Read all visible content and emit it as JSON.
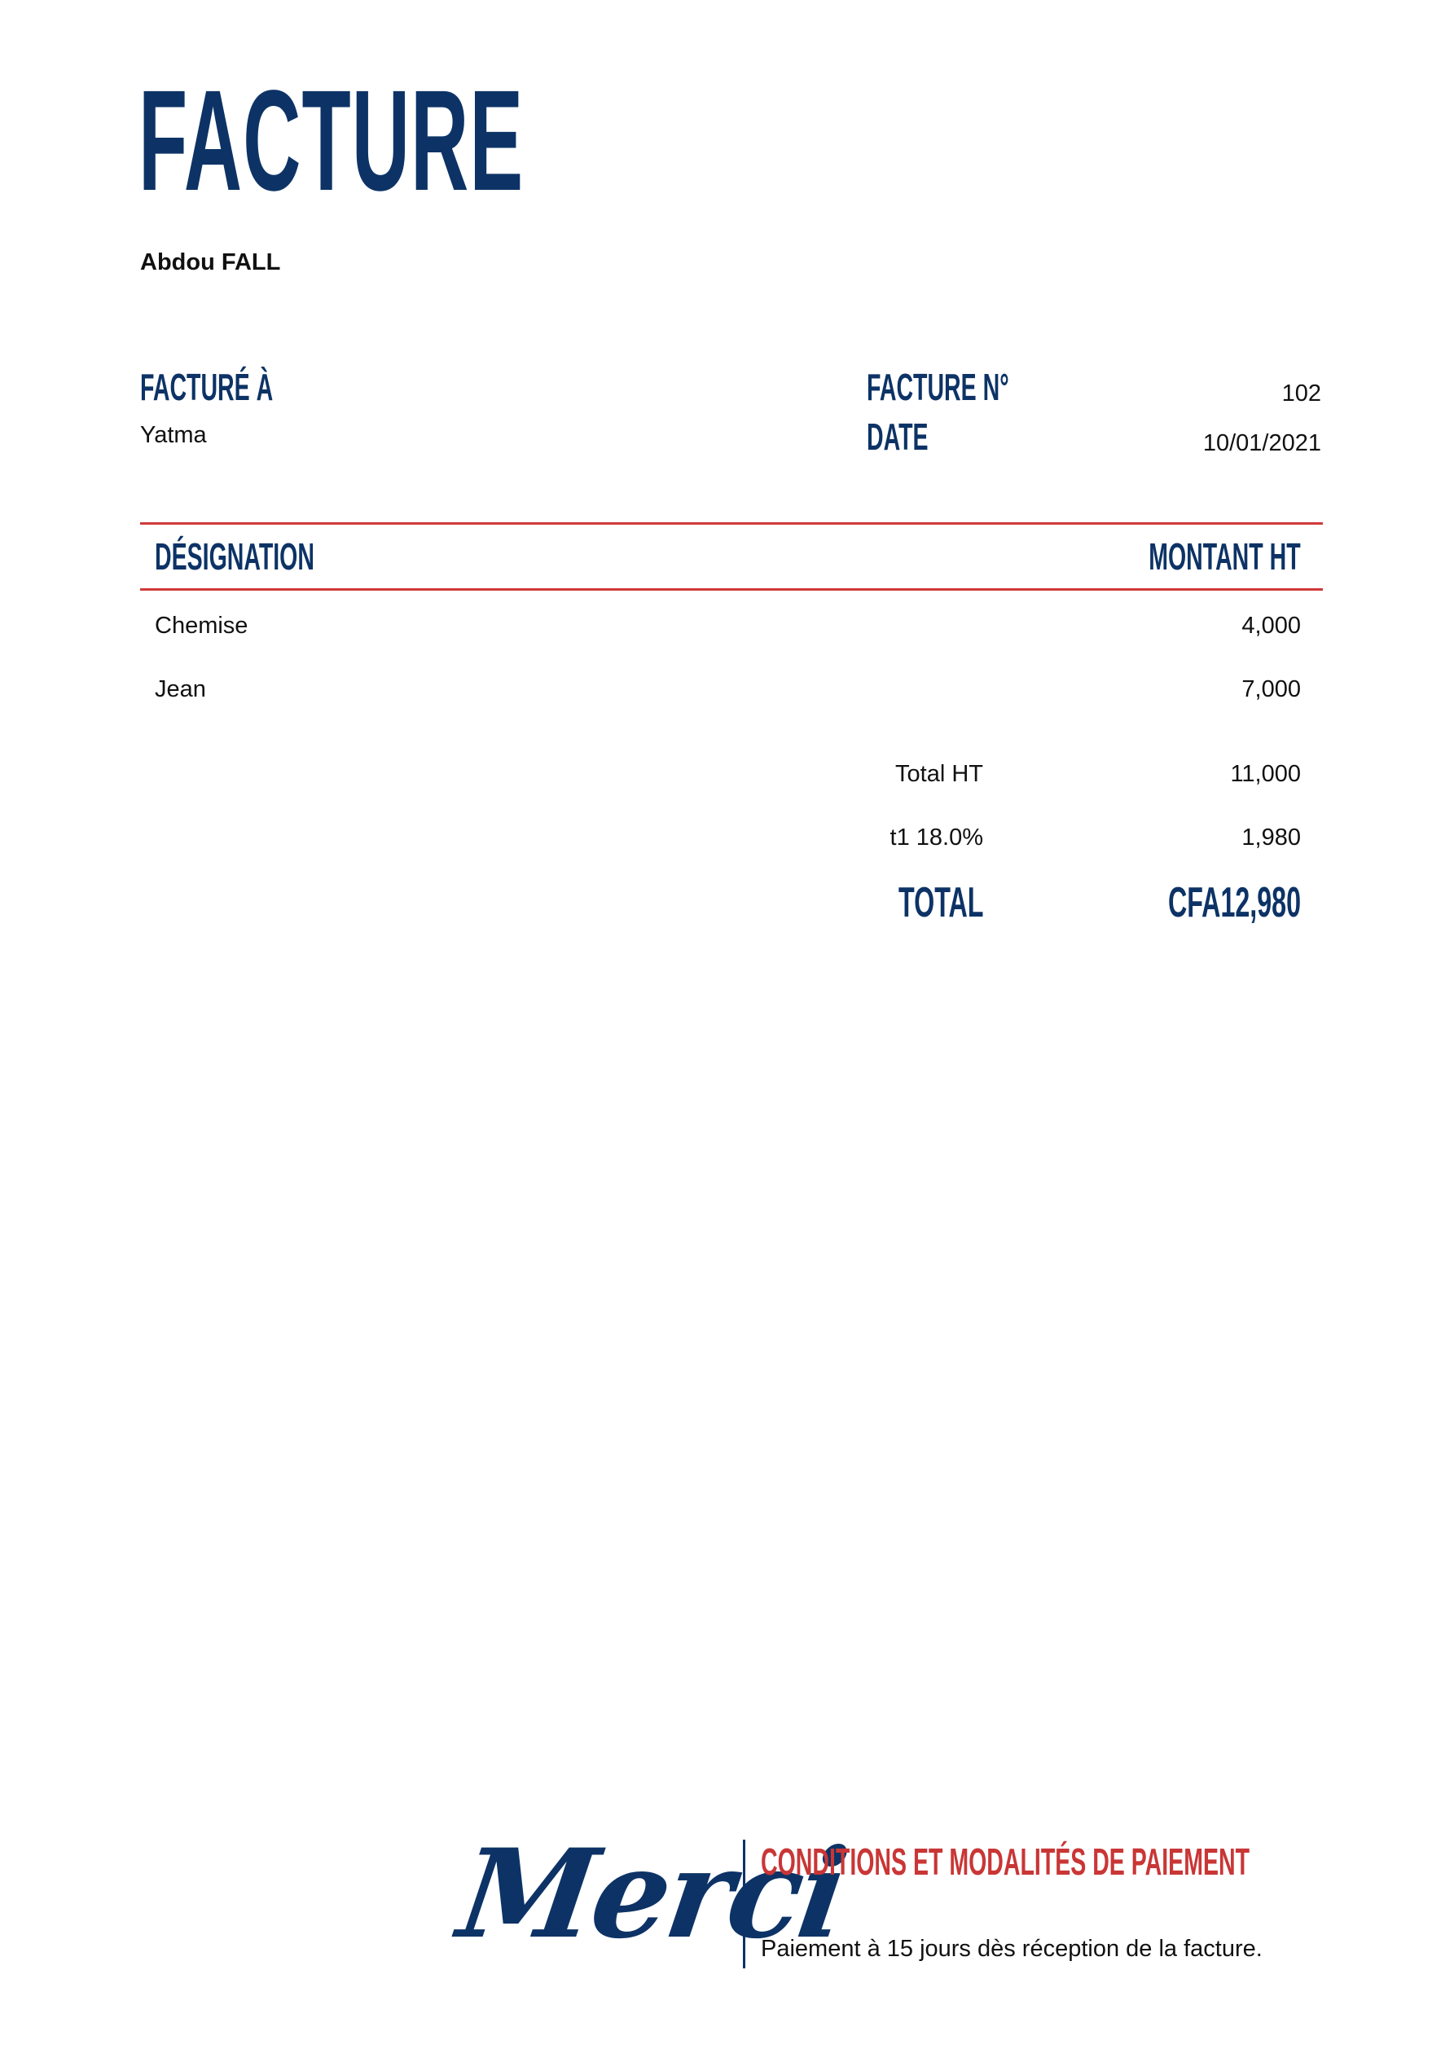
{
  "document": {
    "title": "FACTURE",
    "sender": "Abdou FALL"
  },
  "billing": {
    "billed_to_label": "FACTURÉ À",
    "billed_to_value": "Yatma",
    "invoice_no_label": "FACTURE N°",
    "invoice_no_value": "102",
    "date_label": "DATE",
    "date_value": "10/01/2021"
  },
  "table": {
    "headers": [
      "DÉSIGNATION",
      "MONTANT HT"
    ],
    "rows": [
      {
        "label": "Chemise",
        "amount": "4,000"
      },
      {
        "label": "Jean",
        "amount": "7,000"
      }
    ]
  },
  "totals": {
    "subtotal_label": "Total HT",
    "subtotal_value": "11,000",
    "tax_label": "t1 18.0%",
    "tax_value": "1,980",
    "total_label": "TOTAL",
    "total_value": "CFA12,980"
  },
  "footer": {
    "thanks": "Merci",
    "terms_heading": "CONDITIONS ET MODALITÉS DE PAIEMENT",
    "terms_text": "Paiement à 15 jours dès réception de la facture."
  },
  "colors": {
    "primary": "#0d3366",
    "accent": "#d03a3a",
    "text": "#111111",
    "background": "#ffffff"
  }
}
